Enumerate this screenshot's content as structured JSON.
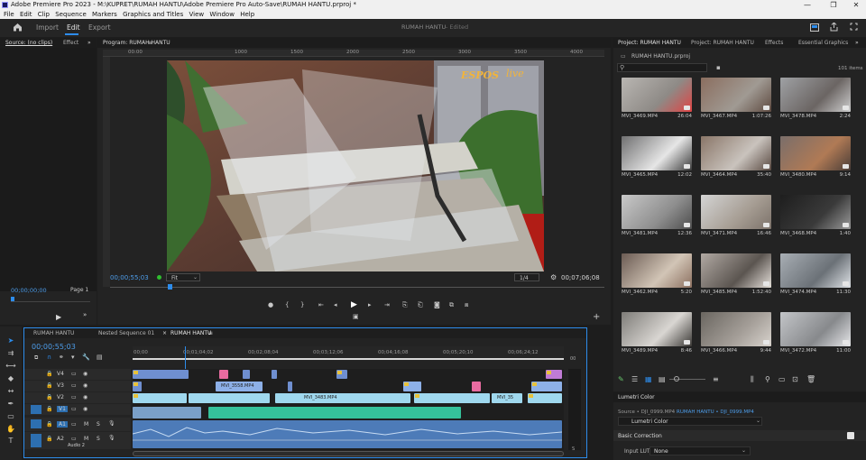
{
  "titlebar": {
    "title": "Adobe Premiere Pro 2023 - M:\\KUPRET\\RUMAH HANTU\\Adobe Premiere Pro Auto-Save\\RUMAH HANTU.prproj *",
    "minimize": "—",
    "maximize": "❐",
    "close": "✕"
  },
  "menu": [
    "File",
    "Edit",
    "Clip",
    "Sequence",
    "Markers",
    "Graphics and Titles",
    "View",
    "Window",
    "Help"
  ],
  "workspace": {
    "home": "home-icon",
    "import": "Import",
    "edit": "Edit",
    "export": "Export",
    "project_title": "RUMAH HANTU",
    "project_status": "- Edited"
  },
  "source_panel": {
    "tab": "Source: (no clips)",
    "tab2": "Effect",
    "timecode": "00;00;00;00",
    "page": "Page 1"
  },
  "program": {
    "tab": "Program: RUMAH HANTU",
    "timecode": "00;00;55;03",
    "fit": "Fit",
    "quality": "1/4",
    "duration": "00;07;06;08",
    "watermark": "ESPOS",
    "watermark2": "live"
  },
  "program_ruler": [
    "00:00",
    "1000",
    "1500",
    "2000",
    "2500",
    "3000",
    "3500",
    "4000",
    "4500"
  ],
  "project": {
    "tabs": [
      "Project: RUMAH HANTU",
      "Project: RUMAH HANTU",
      "Effects",
      "Essential Graphics"
    ],
    "file": "RUMAH HANTU.prproj",
    "search_placeholder": "",
    "items_count": "101 items",
    "clips": [
      {
        "name": "MVI_3469.MP4",
        "dur": "26:04"
      },
      {
        "name": "MVI_3467.MP4",
        "dur": "1:07:26"
      },
      {
        "name": "MVI_3478.MP4",
        "dur": "2:24"
      },
      {
        "name": "MVI_3465.MP4",
        "dur": "12:02"
      },
      {
        "name": "MVI_3464.MP4",
        "dur": "35:40"
      },
      {
        "name": "MVI_3480.MP4",
        "dur": "9:14"
      },
      {
        "name": "MVI_3481.MP4",
        "dur": "12:36"
      },
      {
        "name": "MVI_3471.MP4",
        "dur": "16:46"
      },
      {
        "name": "MVI_3468.MP4",
        "dur": "1:40"
      },
      {
        "name": "MVI_3462.MP4",
        "dur": "5:20"
      },
      {
        "name": "MVI_3485.MP4",
        "dur": "1:52:40"
      },
      {
        "name": "MVI_3474.MP4",
        "dur": "11:30"
      },
      {
        "name": "MVI_3489.MP4",
        "dur": "8:46"
      },
      {
        "name": "MVI_3466.MP4",
        "dur": "9:44"
      },
      {
        "name": "MVI_3472.MP4",
        "dur": "11:00"
      }
    ]
  },
  "lumetri": {
    "tab": "Lumetri Color",
    "source_label": "Source • DJI_0999.MP4",
    "source_seq": "RUMAH HANTU • DJI_0999.MP4",
    "effect": "Lumetri Color",
    "basic": "Basic Correction",
    "input_lut_label": "Input LUT",
    "input_lut_value": "None"
  },
  "timeline": {
    "tabs": [
      "RUMAH HANTU",
      "Nested Sequence 01",
      "RUMAH HANTU"
    ],
    "timecode": "00;00;55;03",
    "ruler": [
      "00;00",
      "00;01;04;02",
      "00;02;08;04",
      "00;03;12;06",
      "00;04;16;08",
      "00;05;20;10",
      "00;06;24;12"
    ],
    "tracks": {
      "v4": "V4",
      "v3": "V3",
      "v2": "V2",
      "v1": "V1",
      "a1": "A1",
      "a2": "A2",
      "audio2": "Audio 2",
      "m": "M",
      "s": "S"
    },
    "clip_labels": {
      "v2_clip": "MVI_3558.MP4",
      "v1_clip": "MVI_3483.MP4",
      "v1_clip2": "MVI_35"
    },
    "meter_db": [
      "00",
      "S",
      "S"
    ]
  }
}
